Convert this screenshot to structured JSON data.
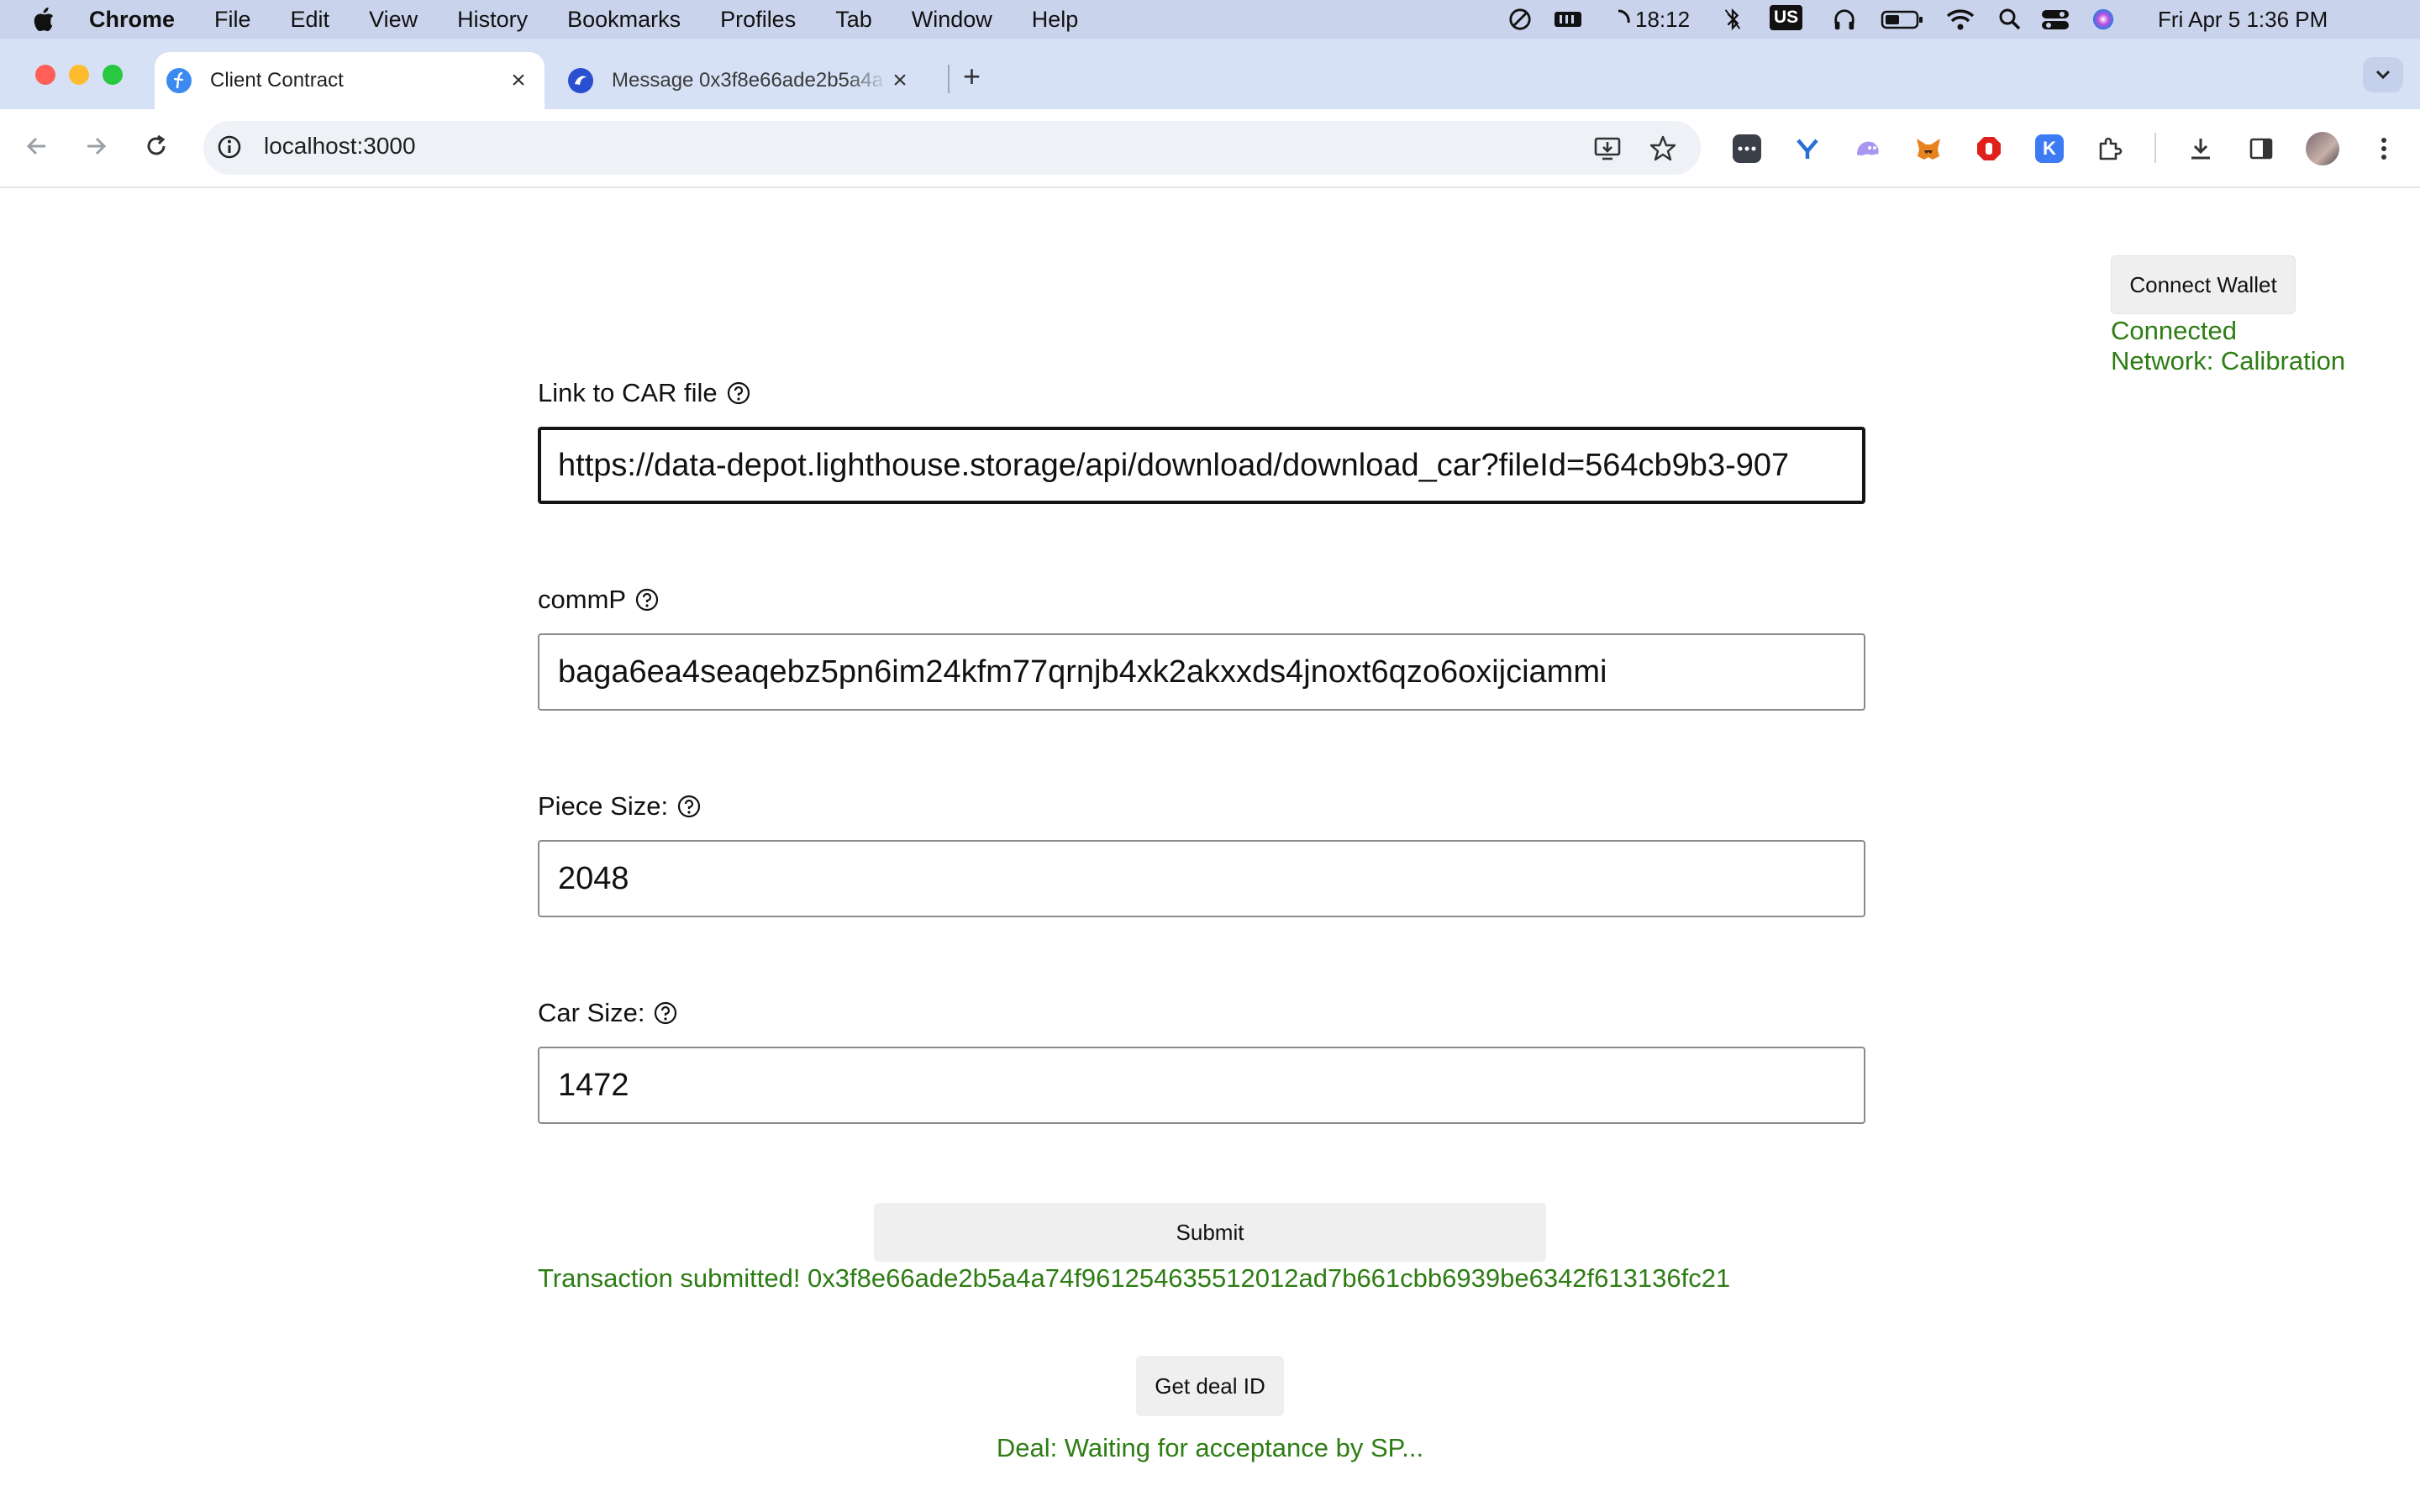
{
  "menubar": {
    "app_name": "Chrome",
    "items": [
      "File",
      "Edit",
      "View",
      "History",
      "Bookmarks",
      "Profiles",
      "Tab",
      "Window",
      "Help"
    ],
    "timer": "18:12",
    "input_source": "US",
    "datetime": "Fri Apr 5  1:36 PM"
  },
  "tabs": [
    {
      "title": "Client Contract",
      "icon": "filecoin-icon"
    },
    {
      "title": "Message 0x3f8e66ade2b5a4a",
      "icon": "filfox-icon"
    }
  ],
  "toolbar": {
    "url": "localhost:3000"
  },
  "page": {
    "connect_button": "Connect Wallet",
    "connection_status": "Connected",
    "network": "Network: Calibration",
    "fields": [
      {
        "label": "Link to CAR file",
        "value": "https://data-depot.lighthouse.storage/api/download/download_car?fileId=564cb9b3-907"
      },
      {
        "label": "commP",
        "value": "baga6ea4seaqebz5pn6im24kfm77qrnjb4xk2akxxds4jnoxt6qzo6oxijciammi"
      },
      {
        "label": "Piece Size:",
        "value": "2048"
      },
      {
        "label": "Car Size:",
        "value": "1472"
      }
    ],
    "submit_button": "Submit",
    "transaction_message": "Transaction submitted! 0x3f8e66ade2b5a4a74f961254635512012ad7b661cbb6939be6342f613136fc21",
    "deal_button": "Get deal ID",
    "deal_status": "Deal: Waiting for acceptance by SP..."
  },
  "colors": {
    "status_green": "#2e7d14",
    "menubar_bg": "#c9d3ec",
    "tabstrip_bg": "#d6e1f6"
  }
}
